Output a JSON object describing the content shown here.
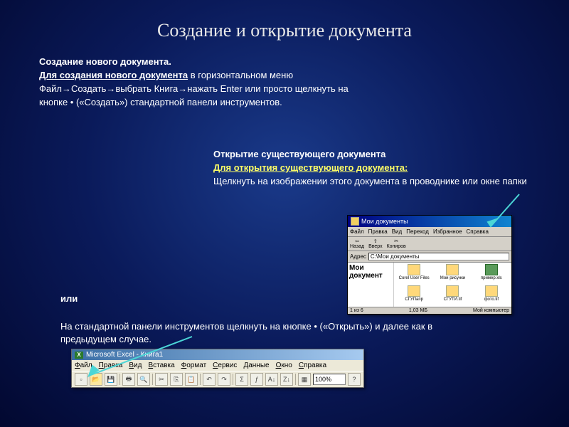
{
  "title": "Создание и открытие документа",
  "create": {
    "heading": "Создание нового документа.",
    "lead": "Для создания нового документа",
    "body": " в горизонтальном меню Файл→Создать→выбрать Книга→нажать Enter или просто щелкнуть на кнопке • («Создать») стандартной панели инструментов."
  },
  "open": {
    "heading": "Открытие существующего документа",
    "lead": "Для открытия существующего документа:",
    "body": "Щелкнуть на изображении этого документа в проводнике или окне папки"
  },
  "or_label": "или",
  "toolbar_hint": "На стандартной панели инструментов щелкнуть на кнопке • («Открыть») и далее как в предыдущем случае.",
  "explorer": {
    "title": "Мои документы",
    "menu": [
      "Файл",
      "Правка",
      "Вид",
      "Переход",
      "Избранное",
      "Справка"
    ],
    "nav": [
      "Назад",
      "Вверх",
      "Копиров"
    ],
    "addr_label": "Адрес",
    "addr_value": "C:\\Мои документы",
    "side": "Мои документ",
    "files": [
      "Corel User Files",
      "Мои рисунки",
      "пример.xls",
      "СГУПапр",
      "СГУТИ.tif",
      "фото.tif"
    ],
    "status_left": "1 из 6",
    "status_right": "1,03 МБ",
    "status_comp": "Мой компьютер"
  },
  "excel": {
    "title": "Microsoft Excel - Книга1",
    "menu": [
      "Файл",
      "Правка",
      "Вид",
      "Вставка",
      "Формат",
      "Сервис",
      "Данные",
      "Окно",
      "Справка"
    ],
    "zoom": "100%"
  }
}
